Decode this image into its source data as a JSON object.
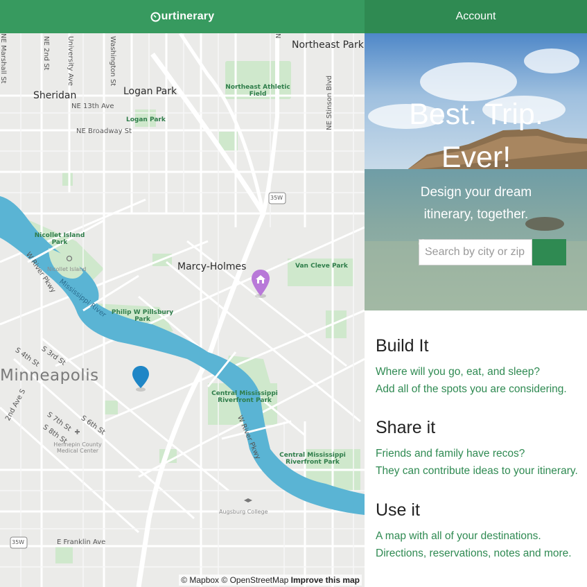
{
  "header": {
    "logo_text": "urtinerary",
    "account_label": "Account"
  },
  "map": {
    "labels": {
      "northeast_park": "Northeast Park",
      "sheridan": "Sheridan",
      "logan_park": "Logan Park",
      "ne_13th": "NE 13th Ave",
      "ne_broadway": "NE Broadway St",
      "logan_park_park": "Logan Park",
      "ne_athletic": "Northeast Athletic Field",
      "ne_stinson": "NE Stinson Blvd",
      "marshall": "NE Marshall St",
      "ne_2nd": "NE 2nd St",
      "university": "University Ave",
      "washington": "Washington St",
      "nicollet_island_park": "Nicollet Island Park",
      "nicollet_island": "Nicollet Island",
      "w_river_pkwy": "W River Pkwy",
      "mississippi_river": "Mississippi River",
      "marcy_holmes": "Marcy-Holmes",
      "van_cleve": "Van Cleve Park",
      "pillsbury": "Philip W Pillsbury Park",
      "minneapolis": "Minneapolis",
      "s_3rd": "S 3rd St",
      "s_4th": "S 4th St",
      "s_2nd_ave": "2nd Ave S",
      "s_7th": "S 7th St",
      "s_6th": "S 6th St",
      "s_8th": "S 8th St",
      "hennepin": "Hennepin County Medical Center",
      "central_miss_1": "Central Mississippi Riverfront Park",
      "central_miss_2": "Central Mississippi Riverfront Park",
      "w_river_pkwy_2": "W River Pkwy",
      "augsburg": "Augsburg College",
      "franklin": "E Franklin Ave",
      "i35w": "35W",
      "i35w_2": "35W",
      "n_short": "N"
    },
    "attribution": {
      "mapbox": "© Mapbox",
      "osm": "© OpenStreetMap",
      "improve": "Improve this map"
    },
    "marker_colors": {
      "purple": "#b878d8",
      "blue": "#1f86c6"
    }
  },
  "hero": {
    "title_line1": "Best. Trip.",
    "title_line2": "Ever!",
    "subtitle_line1": "Design your dream",
    "subtitle_line2": "itinerary, together.",
    "search_placeholder": "Search by city or zip"
  },
  "sections": [
    {
      "heading": "Build It",
      "line1": "Where will you go, eat, and sleep?",
      "line2": "Add all of the spots you are considering."
    },
    {
      "heading": "Share it",
      "line1": "Friends and family have recos?",
      "line2": "They can contribute ideas to your itinerary."
    },
    {
      "heading": "Use it",
      "line1": "A map with all of your destinations.",
      "line2": "Directions, reservations, notes and more."
    }
  ],
  "colors": {
    "brand_green": "#379a5f",
    "brand_green_dark": "#2f8a52",
    "river": "#5ab4d4",
    "park": "#c7e4c4"
  },
  "icons": {
    "logo": "logo-o-icon",
    "search": "search-icon",
    "marker_home": "home-marker-icon",
    "marker_pin": "map-pin-icon"
  }
}
